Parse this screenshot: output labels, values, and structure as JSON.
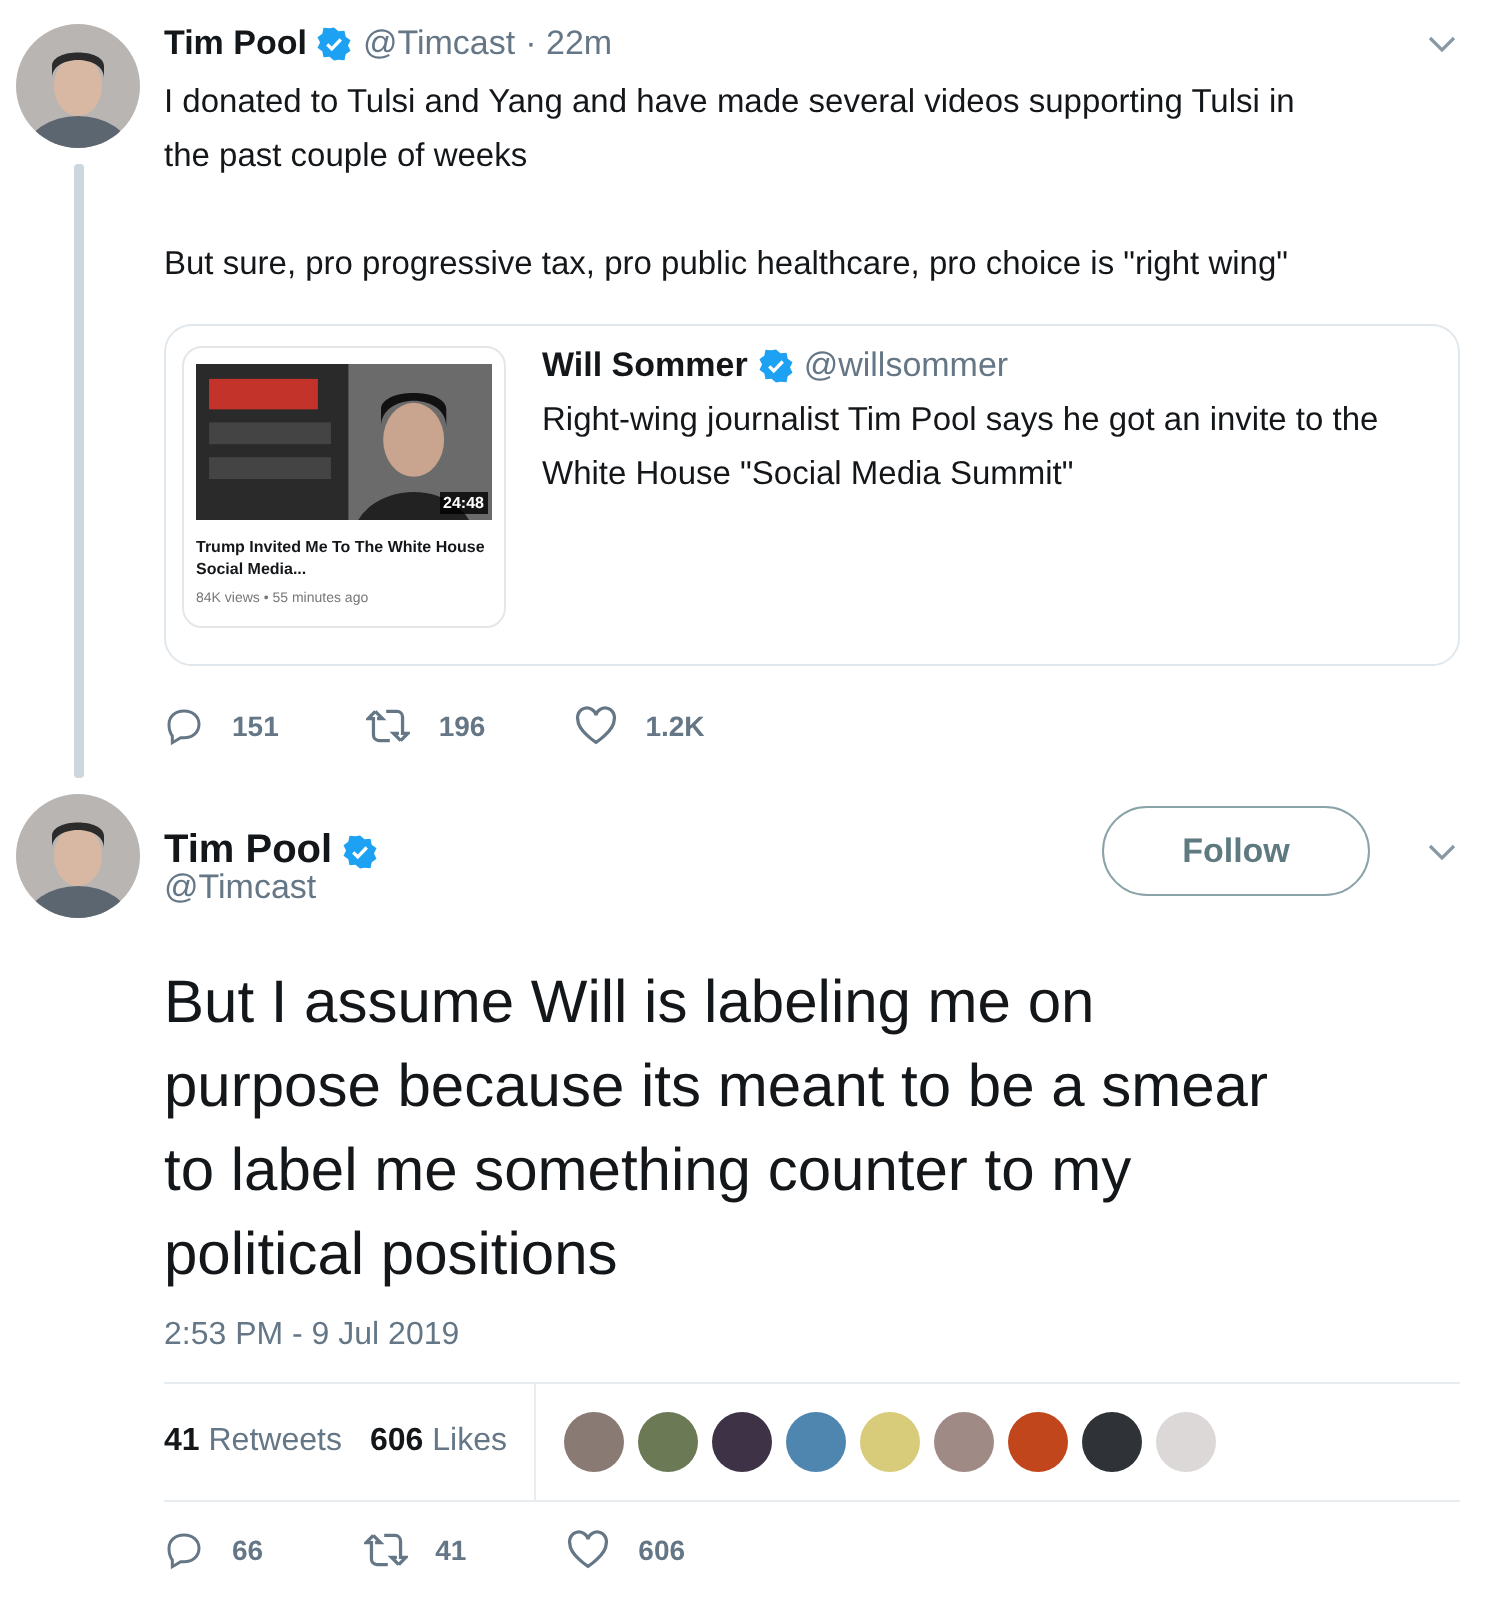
{
  "reply_tweet": {
    "name": "Tim Pool",
    "verified": true,
    "handle": "@Timcast",
    "time": "· 22m",
    "paragraphs": [
      "I donated to Tulsi and Yang and have made several videos supporting Tulsi in the past couple of weeks",
      "But sure, pro progressive tax, pro public healthcare, pro choice is \"right wing\""
    ],
    "quote": {
      "video": {
        "kind": "picture",
        "duration": "24:48",
        "title": "Trump Invited Me To The White House Social Media...",
        "meta": "84K views • 55 minutes ago"
      },
      "name": "Will Sommer",
      "verified": true,
      "handle": "@willsommer",
      "text": "Right-wing journalist Tim Pool says he got an invite to the White House \"Social Media Summit\""
    },
    "actions": [
      {
        "kind": "reply",
        "count": "151"
      },
      {
        "kind": "retweet",
        "count": "196"
      },
      {
        "kind": "like",
        "count": "1.2K"
      }
    ]
  },
  "main_tweet": {
    "name": "Tim Pool",
    "verified": true,
    "handle": "@Timcast",
    "follow_button": "Follow",
    "text": "But I assume Will is labeling me on purpose because its meant to be a smear to label me something counter to my political positions",
    "timestamp": "2:53 PM - 9 Jul 2019",
    "stats": [
      {
        "count": "41",
        "label": "Retweets"
      },
      {
        "count": "606",
        "label": "Likes"
      }
    ],
    "likers": [
      {
        "color": "#8a7a74"
      },
      {
        "color": "#6b7a55"
      },
      {
        "color": "#3e3346"
      },
      {
        "color": "#4f86b0"
      },
      {
        "color": "#d8cc7a"
      },
      {
        "color": "#a08a86"
      },
      {
        "color": "#c2461c"
      },
      {
        "color": "#2f3338"
      },
      {
        "color": "#dcd8d8"
      }
    ],
    "actions": [
      {
        "kind": "reply",
        "count": "66"
      },
      {
        "kind": "retweet",
        "count": "41"
      },
      {
        "kind": "like",
        "count": "606"
      }
    ]
  }
}
